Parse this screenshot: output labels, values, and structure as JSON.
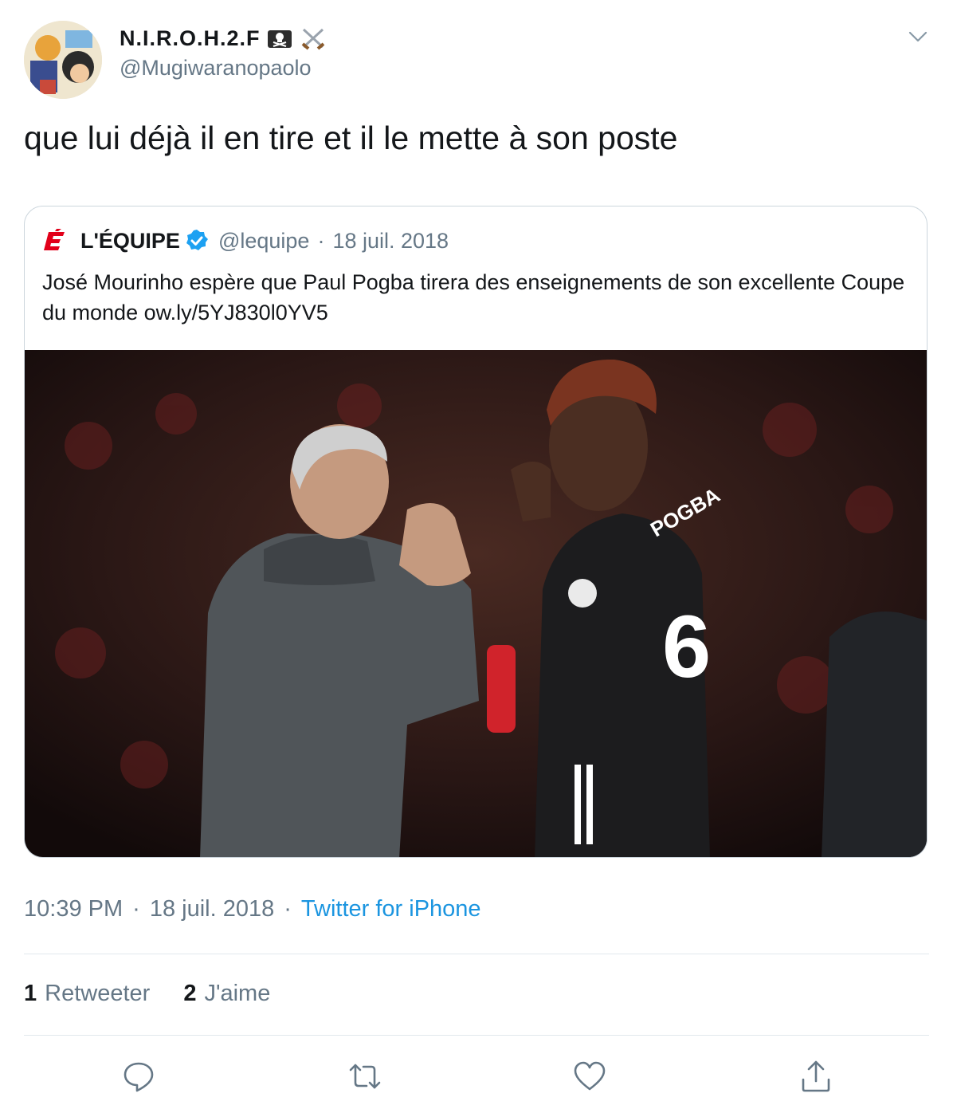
{
  "author": {
    "display_name": "N.I.R.O.H.2.F",
    "name_emoji": "pirate-flag-and-crossed-swords-icon",
    "handle": "@Mugiwaranopaolo"
  },
  "tweet": {
    "text": "que lui déjà il en tire et il le mette à son poste",
    "time": "10:39 PM",
    "separator": "·",
    "date": "18 juil. 2018",
    "source": "Twitter for iPhone"
  },
  "quoted": {
    "logo": "lequipe-logo",
    "name": "L'ÉQUIPE",
    "handle": "@lequipe",
    "separator": "·",
    "date": "18 juil. 2018",
    "text": "José Mourinho espère que Paul Pogba tirera des enseignements de son excellente Coupe du monde ow.ly/5YJ830l0YV5",
    "image_description": "photo"
  },
  "stats": {
    "retweets_count": "1",
    "retweets_label": "Retweeter",
    "likes_count": "2",
    "likes_label": "J'aime"
  },
  "actions": [
    "reply-icon",
    "retweet-icon",
    "like-icon",
    "share-icon"
  ],
  "colors": {
    "text": "#14171a",
    "secondary": "#657786",
    "link": "#1b95e0",
    "verified": "#1da1f2",
    "border": "#e1e8ed",
    "lequipe_red": "#e2001a"
  }
}
